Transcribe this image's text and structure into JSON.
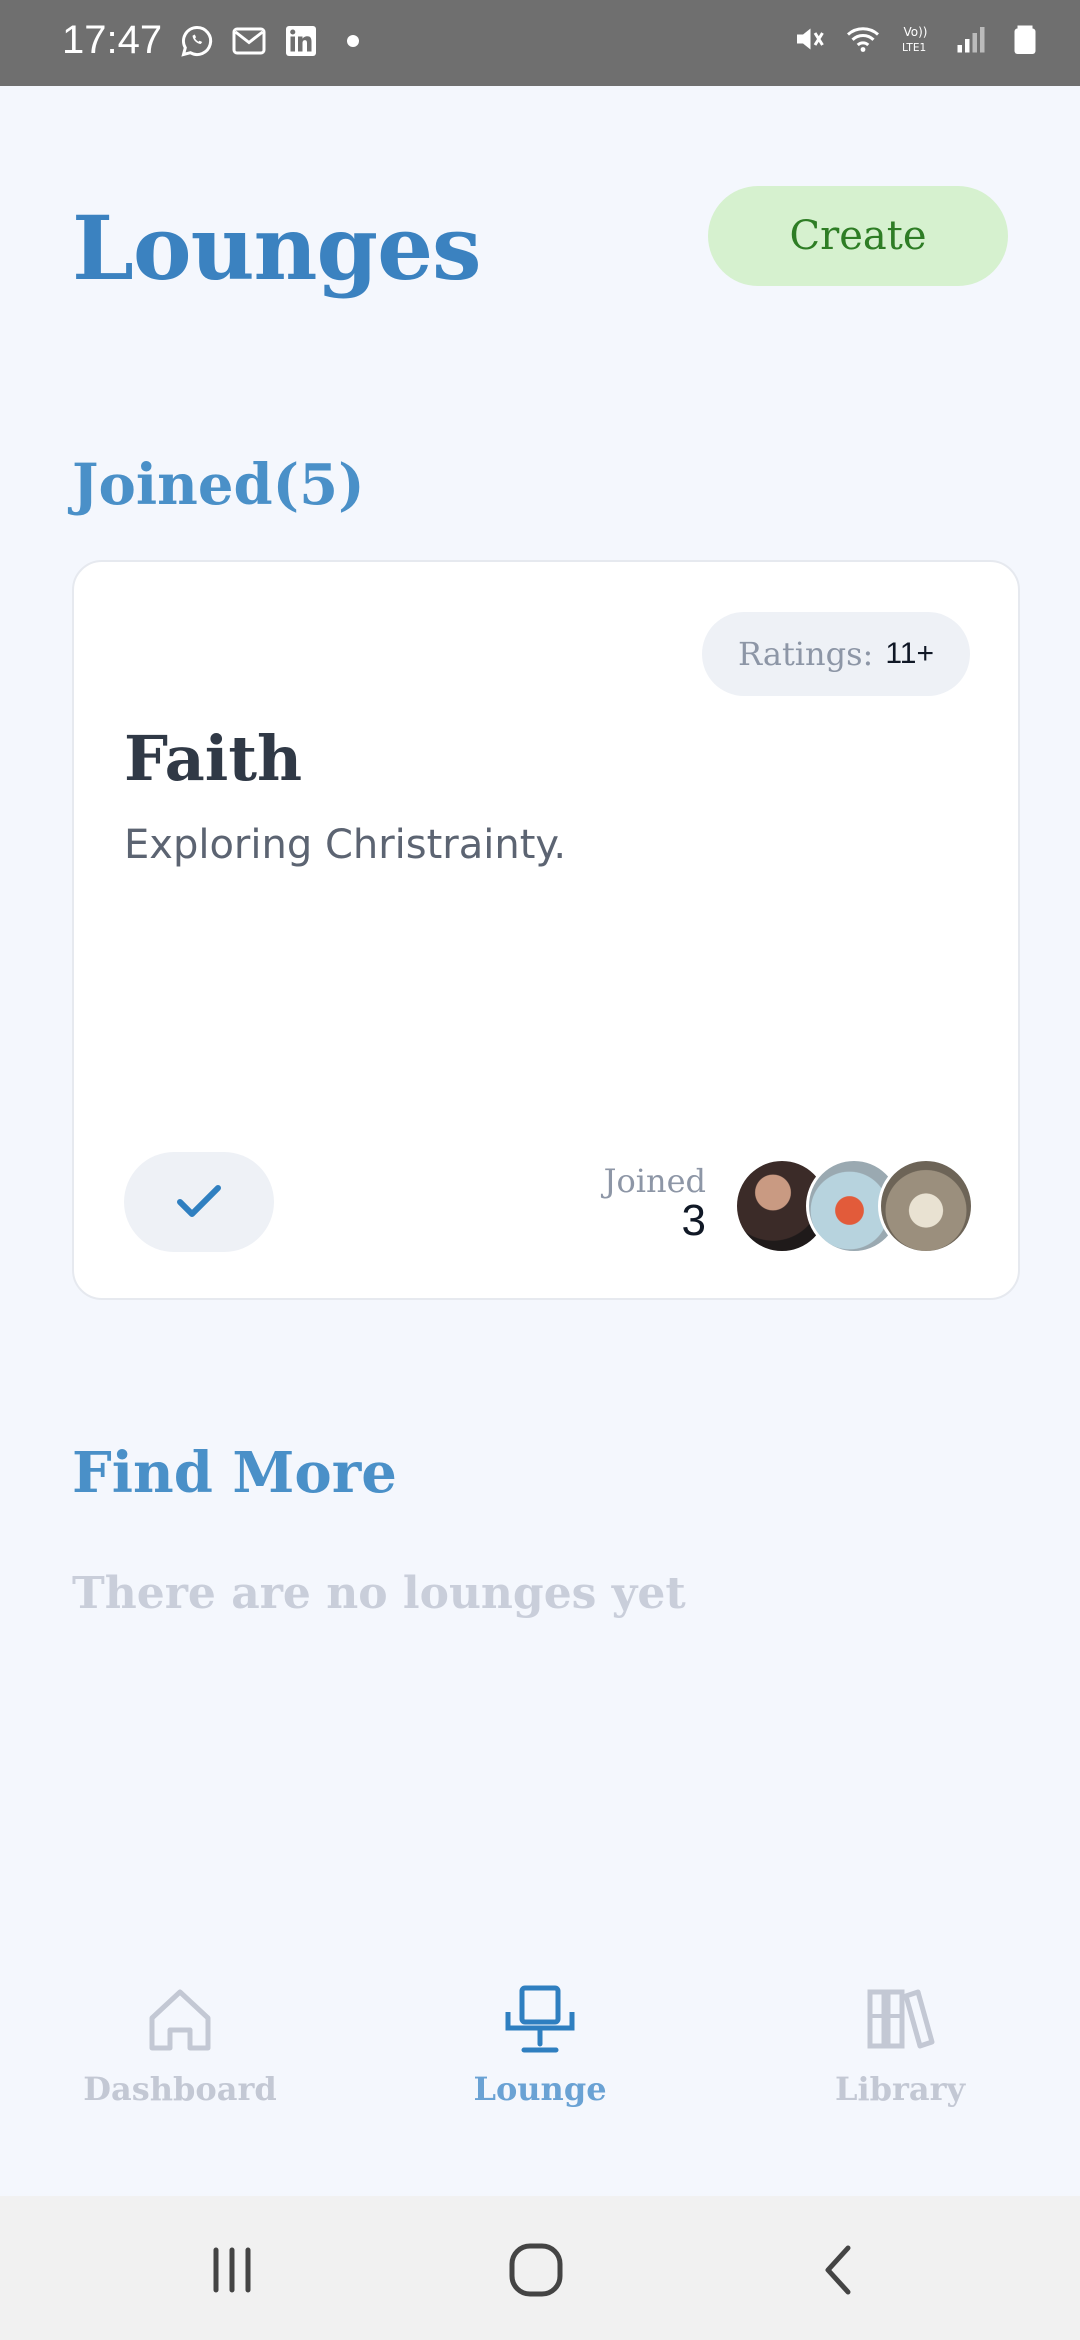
{
  "status_bar": {
    "time": "17:47",
    "left_icons": [
      "whatsapp-icon",
      "gmail-icon",
      "linkedin-icon",
      "dot-icon"
    ],
    "right_icons": [
      "mute-icon",
      "wifi-icon",
      "volte-icon",
      "signal-icon",
      "battery-icon"
    ]
  },
  "header": {
    "title": "Lounges",
    "create_label": "Create",
    "create_color": "#d6f1cf"
  },
  "joined_section": {
    "title": "Joined(5)",
    "lounges": [
      {
        "ratings_label": "Ratings:",
        "ratings_value": "11+",
        "name": "Faith",
        "description": "Exploring Christrainty.",
        "joined_label": "Joined",
        "joined_count": "3",
        "joined_state_icon": "check-icon"
      }
    ]
  },
  "find_more": {
    "title": "Find More",
    "empty_message": "There are no lounges yet"
  },
  "bottom_nav": {
    "items": [
      {
        "label": "Dashboard",
        "icon": "home-icon",
        "active": false
      },
      {
        "label": "Lounge",
        "icon": "lounge-chair-icon",
        "active": true
      },
      {
        "label": "Library",
        "icon": "library-books-icon",
        "active": false
      }
    ]
  },
  "colors": {
    "accent": "#3b82c0",
    "active_nav": "#2f7fc0",
    "inactive_nav": "#c3c8d4"
  }
}
